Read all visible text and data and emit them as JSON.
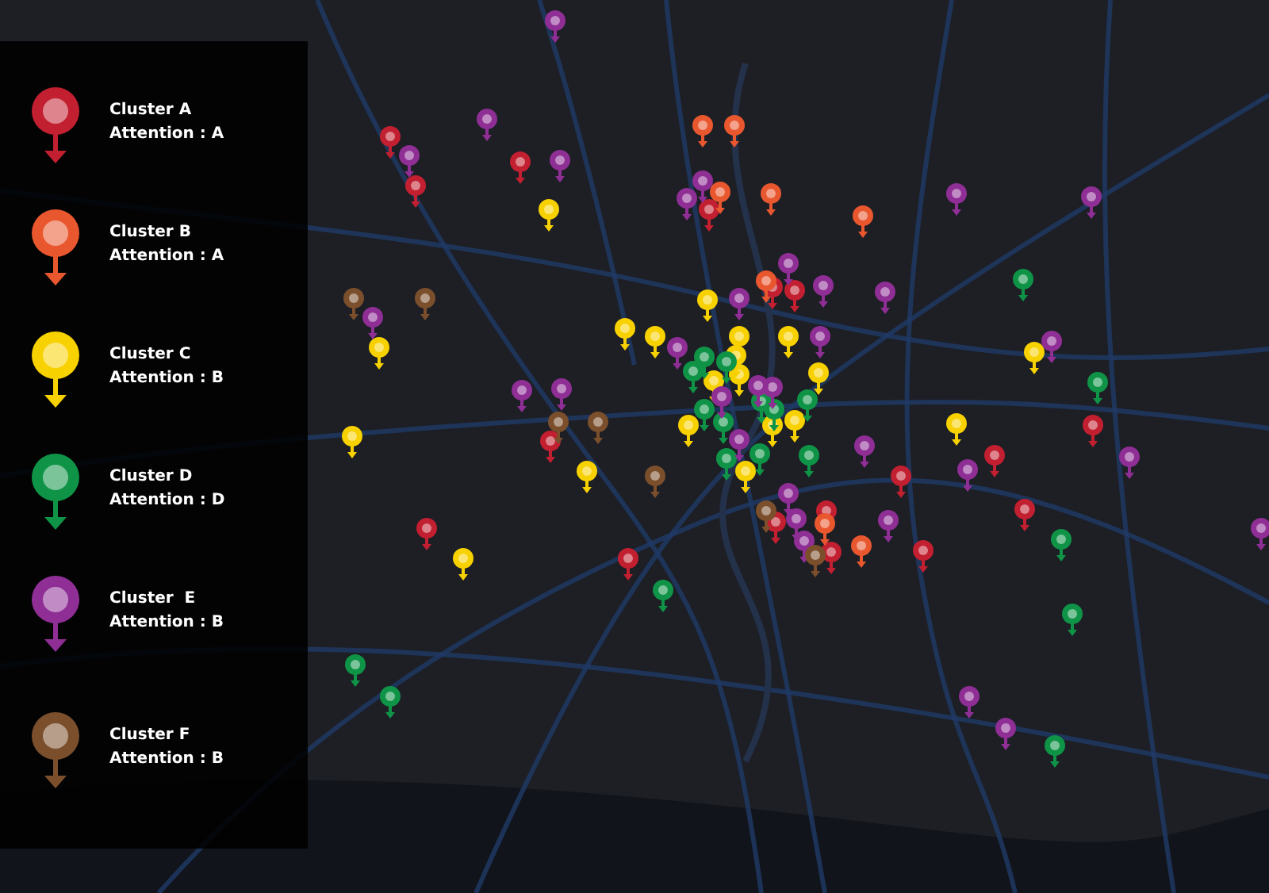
{
  "legend": {
    "items": [
      {
        "label": "Cluster A",
        "attention": "Attention : A",
        "color": "#c21f30"
      },
      {
        "label": "Cluster B",
        "attention": "Attention : A",
        "color": "#e9572f"
      },
      {
        "label": "Cluster C",
        "attention": "Attention : B",
        "color": "#f8d100"
      },
      {
        "label": "Cluster D",
        "attention": "Attention : D",
        "color": "#0f9447"
      },
      {
        "label": "Cluster  E",
        "attention": "Attention : B",
        "color": "#8f2e95"
      },
      {
        "label": "Cluster F",
        "attention": "Attention : B",
        "color": "#7b4f2c"
      }
    ]
  }
}
